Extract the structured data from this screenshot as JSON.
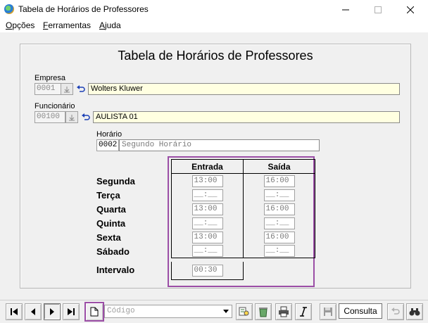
{
  "window": {
    "title": "Tabela de Horários de Professores"
  },
  "menu": [
    {
      "accel": "O",
      "rest": "pções"
    },
    {
      "accel": "F",
      "rest": "erramentas"
    },
    {
      "accel": "A",
      "rest": "juda"
    }
  ],
  "form": {
    "heading": "Tabela de Horários de Professores",
    "empresa": {
      "label": "Empresa",
      "code": "0001",
      "name": "Wolters Kluwer"
    },
    "funcionario": {
      "label": "Funcionário",
      "code": "00100",
      "name": "AULISTA 01"
    },
    "horario": {
      "label": "Horário",
      "code": "0002",
      "name": "Segundo Horário"
    }
  },
  "schedule": {
    "col_entrada": "Entrada",
    "col_saida": "Saída",
    "days": [
      {
        "day": "Segunda",
        "entrada": "13:00",
        "saida": "16:00"
      },
      {
        "day": "Terça",
        "entrada": "__:__",
        "saida": "__:__"
      },
      {
        "day": "Quarta",
        "entrada": "13:00",
        "saida": "16:00"
      },
      {
        "day": "Quinta",
        "entrada": "__:__",
        "saida": "__:__"
      },
      {
        "day": "Sexta",
        "entrada": "13:00",
        "saida": "16:00"
      },
      {
        "day": "Sábado",
        "entrada": "__:__",
        "saida": "__:__"
      }
    ],
    "intervalo_label": "Intervalo",
    "intervalo": "00:30"
  },
  "toolbar": {
    "search_placeholder": "Código",
    "consulta_label": "Consulta"
  },
  "colors": {
    "highlight_border": "#9b4ea6",
    "field_yellow": "#ffffe1"
  }
}
